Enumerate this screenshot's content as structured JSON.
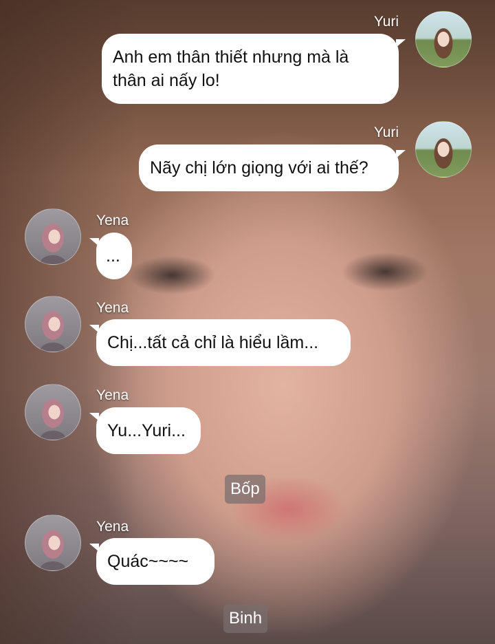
{
  "messages": [
    {
      "sender": "Yuri",
      "side": "right",
      "text_line1": "Anh em thân thiết nhưng mà là",
      "text_line2": "thân ai nấy lo!"
    },
    {
      "sender": "Yuri",
      "side": "right",
      "text": "Nãy chị lớn giọng với ai thế?"
    },
    {
      "sender": "Yena",
      "side": "left",
      "text": "..."
    },
    {
      "sender": "Yena",
      "side": "left",
      "text": "Chị...tất cả chỉ là hiểu lầm..."
    },
    {
      "sender": "Yena",
      "side": "left",
      "text": "Yu...Yuri..."
    },
    {
      "system": "Bốp"
    },
    {
      "sender": "Yena",
      "side": "left",
      "text": "Quác~~~~"
    },
    {
      "system": "Binh"
    }
  ]
}
